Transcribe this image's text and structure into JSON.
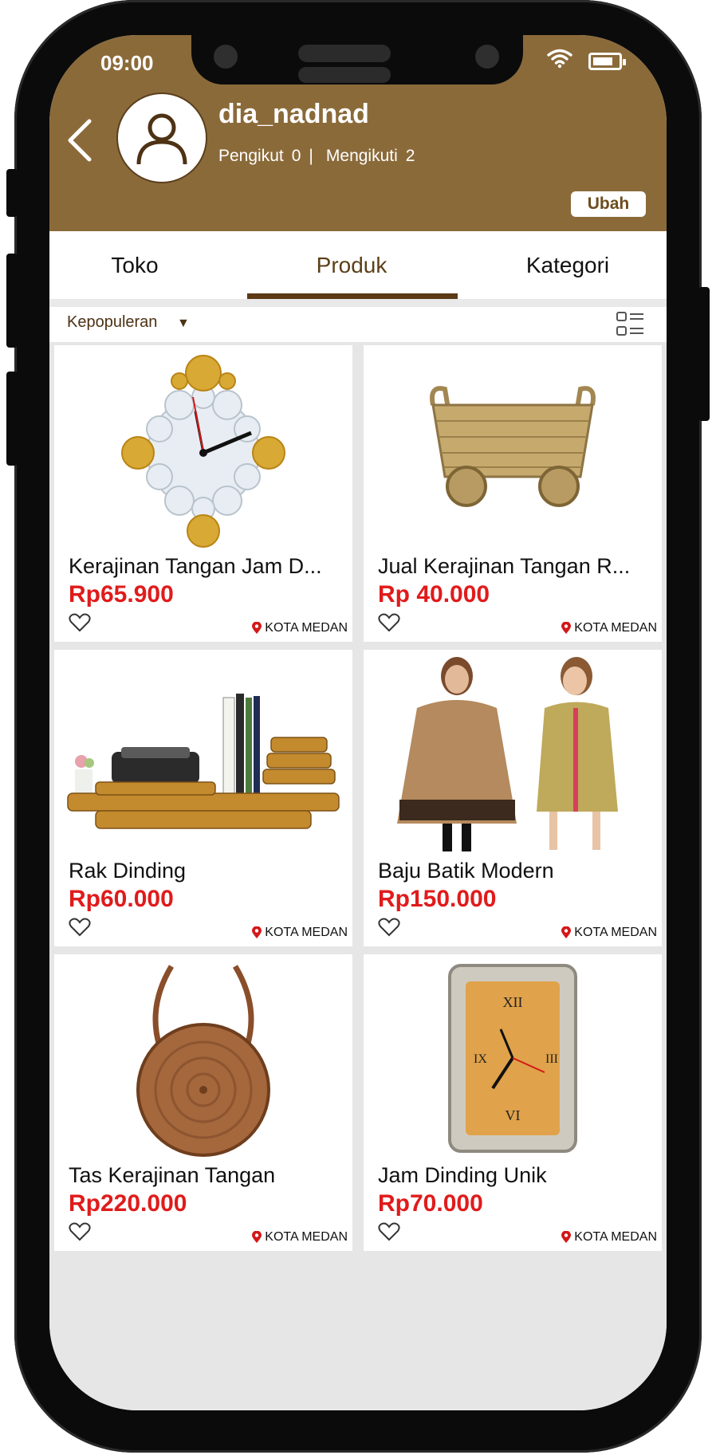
{
  "status": {
    "time": "09:00"
  },
  "profile": {
    "username": "dia_nadnad",
    "followers_label": "Pengikut",
    "followers_count": "0",
    "divider": "|",
    "following_label": "Mengikuti",
    "following_count": "2",
    "edit_label": "Ubah"
  },
  "tabs": [
    {
      "label": "Toko",
      "active": false
    },
    {
      "label": "Produk",
      "active": true
    },
    {
      "label": "Kategori",
      "active": false
    }
  ],
  "sort": {
    "label": "Kepopuleran",
    "arrow": "▼"
  },
  "products": [
    {
      "name": "Kerajinan Tangan Jam D...",
      "price": "Rp65.900",
      "location": "KOTA MEDAN",
      "image": "decorative wall clock"
    },
    {
      "name": "Jual Kerajinan Tangan R...",
      "price": "Rp 40.000",
      "location": "KOTA MEDAN",
      "image": "rattan basket cart"
    },
    {
      "name": "Rak Dinding",
      "price": "Rp60.000",
      "location": "KOTA MEDAN",
      "image": "wall shelf"
    },
    {
      "name": "Baju Batik Modern",
      "price": "Rp150.000",
      "location": "KOTA MEDAN",
      "image": "batik clothing"
    },
    {
      "name": "Tas Kerajinan Tangan",
      "price": "Rp220.000",
      "location": "KOTA MEDAN",
      "image": "round rattan bag"
    },
    {
      "name": "Jam Dinding Unik",
      "price": "Rp70.000",
      "location": "KOTA MEDAN",
      "image": "square wall clock"
    }
  ],
  "colors": {
    "header": "#8b6a3a",
    "price": "#e01b1b",
    "tab_active": "#5c3a16"
  }
}
